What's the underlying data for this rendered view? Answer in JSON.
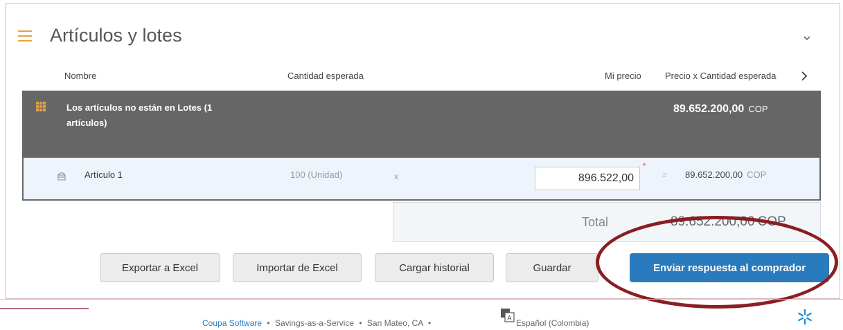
{
  "section": {
    "title": "Artículos y lotes"
  },
  "columns": {
    "nombre": "Nombre",
    "cantidad": "Cantidad esperada",
    "precio": "Mi precio",
    "total": "Precio x Cantidad esperada"
  },
  "group": {
    "label": "Los artículos no están en Lotes (1 artículos)",
    "total": "89.652.200,00",
    "currency": "COP"
  },
  "item": {
    "name": "Artículo 1",
    "quantity": "100 (Unidad)",
    "times": "x",
    "price": "896.522,00",
    "required_mark": "*",
    "equals": "=",
    "total": "89.652.200,00",
    "currency": "COP"
  },
  "summary": {
    "label": "Total",
    "value": "89.652.200,00",
    "currency": "COP"
  },
  "buttons": {
    "export": "Exportar a Excel",
    "import": "Importar de Excel",
    "history": "Cargar historial",
    "save": "Guardar",
    "submit": "Enviar respuesta al comprador"
  },
  "footer": {
    "company": "Coupa Software",
    "sep": "•",
    "tagline": "Savings-as-a-Service",
    "location": "San Mateo, CA",
    "language": "Español (Colombia)"
  },
  "colors": {
    "accent": "#2a7bbd",
    "group_bg": "#666666",
    "highlight_ring": "#8b1e23",
    "icon_orange": "#e8a23c"
  }
}
